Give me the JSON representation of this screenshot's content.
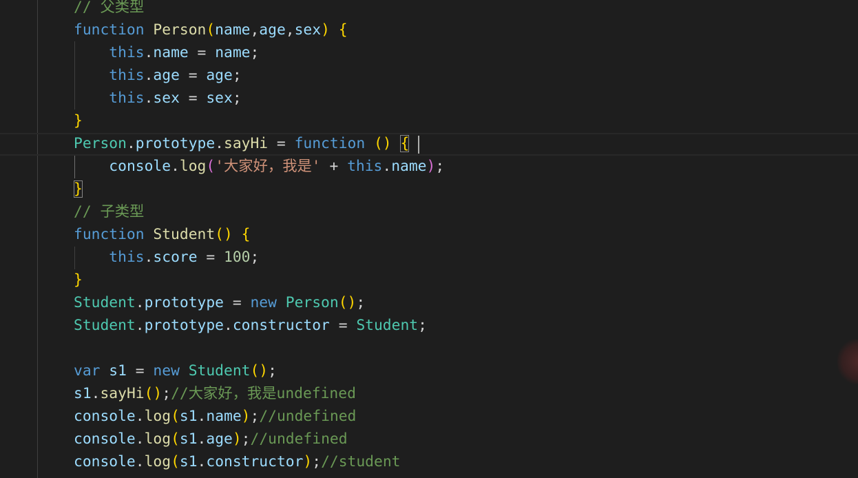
{
  "editor": {
    "language": "javascript",
    "colors": {
      "background": "#1e1e1e",
      "keyword": "#569cd6",
      "function": "#dcdcaa",
      "class": "#4ec9b0",
      "variable": "#9cdcfe",
      "string": "#ce9178",
      "number": "#b5cea8",
      "comment": "#6a9955",
      "bracket_level_1": "#ffd700",
      "bracket_level_2": "#da70d6"
    },
    "lines": [
      {
        "tokens": [
          {
            "t": "// 父类型",
            "k": "comment"
          }
        ]
      },
      {
        "tokens": [
          {
            "t": "function",
            "k": "keyword"
          },
          {
            "t": " ",
            "k": "punct"
          },
          {
            "t": "Person",
            "k": "function"
          },
          {
            "t": "(",
            "k": "bracket-1"
          },
          {
            "t": "name",
            "k": "param"
          },
          {
            "t": ",",
            "k": "punct"
          },
          {
            "t": "age",
            "k": "param"
          },
          {
            "t": ",",
            "k": "punct"
          },
          {
            "t": "sex",
            "k": "param"
          },
          {
            "t": ")",
            "k": "bracket-1"
          },
          {
            "t": " ",
            "k": "punct"
          },
          {
            "t": "{",
            "k": "bracket-1"
          }
        ]
      },
      {
        "tokens": [
          {
            "t": "    ",
            "k": "punct"
          },
          {
            "t": "this",
            "k": "keyword"
          },
          {
            "t": ".",
            "k": "punct"
          },
          {
            "t": "name",
            "k": "property"
          },
          {
            "t": " = ",
            "k": "operator"
          },
          {
            "t": "name",
            "k": "param"
          },
          {
            "t": ";",
            "k": "punct"
          }
        ]
      },
      {
        "tokens": [
          {
            "t": "    ",
            "k": "punct"
          },
          {
            "t": "this",
            "k": "keyword"
          },
          {
            "t": ".",
            "k": "punct"
          },
          {
            "t": "age",
            "k": "property"
          },
          {
            "t": " = ",
            "k": "operator"
          },
          {
            "t": "age",
            "k": "param"
          },
          {
            "t": ";",
            "k": "punct"
          }
        ]
      },
      {
        "tokens": [
          {
            "t": "    ",
            "k": "punct"
          },
          {
            "t": "this",
            "k": "keyword"
          },
          {
            "t": ".",
            "k": "punct"
          },
          {
            "t": "sex",
            "k": "property"
          },
          {
            "t": " = ",
            "k": "operator"
          },
          {
            "t": "sex",
            "k": "param"
          },
          {
            "t": ";",
            "k": "punct"
          }
        ]
      },
      {
        "tokens": [
          {
            "t": "}",
            "k": "bracket-1"
          }
        ]
      },
      {
        "tokens": [
          {
            "t": "Person",
            "k": "class"
          },
          {
            "t": ".",
            "k": "punct"
          },
          {
            "t": "prototype",
            "k": "property"
          },
          {
            "t": ".",
            "k": "punct"
          },
          {
            "t": "sayHi",
            "k": "function"
          },
          {
            "t": " = ",
            "k": "operator"
          },
          {
            "t": "function",
            "k": "keyword"
          },
          {
            "t": " ",
            "k": "punct"
          },
          {
            "t": "()",
            "k": "bracket-1"
          },
          {
            "t": " ",
            "k": "punct"
          },
          {
            "t": "{",
            "k": "bracket-1",
            "match": true
          }
        ]
      },
      {
        "tokens": [
          {
            "t": "    ",
            "k": "punct"
          },
          {
            "t": "console",
            "k": "variable"
          },
          {
            "t": ".",
            "k": "punct"
          },
          {
            "t": "log",
            "k": "function"
          },
          {
            "t": "(",
            "k": "bracket-2"
          },
          {
            "t": "'大家好，我是'",
            "k": "string"
          },
          {
            "t": " + ",
            "k": "operator"
          },
          {
            "t": "this",
            "k": "keyword"
          },
          {
            "t": ".",
            "k": "punct"
          },
          {
            "t": "name",
            "k": "property"
          },
          {
            "t": ")",
            "k": "bracket-2"
          },
          {
            "t": ";",
            "k": "punct"
          }
        ]
      },
      {
        "tokens": [
          {
            "t": "}",
            "k": "bracket-1",
            "match": true
          }
        ]
      },
      {
        "tokens": [
          {
            "t": "// 子类型",
            "k": "comment"
          }
        ]
      },
      {
        "tokens": [
          {
            "t": "function",
            "k": "keyword"
          },
          {
            "t": " ",
            "k": "punct"
          },
          {
            "t": "Student",
            "k": "function"
          },
          {
            "t": "()",
            "k": "bracket-1"
          },
          {
            "t": " ",
            "k": "punct"
          },
          {
            "t": "{",
            "k": "bracket-1"
          }
        ]
      },
      {
        "tokens": [
          {
            "t": "    ",
            "k": "punct"
          },
          {
            "t": "this",
            "k": "keyword"
          },
          {
            "t": ".",
            "k": "punct"
          },
          {
            "t": "score",
            "k": "property"
          },
          {
            "t": " = ",
            "k": "operator"
          },
          {
            "t": "100",
            "k": "number"
          },
          {
            "t": ";",
            "k": "punct"
          }
        ]
      },
      {
        "tokens": [
          {
            "t": "}",
            "k": "bracket-1"
          }
        ]
      },
      {
        "tokens": [
          {
            "t": "Student",
            "k": "class"
          },
          {
            "t": ".",
            "k": "punct"
          },
          {
            "t": "prototype",
            "k": "property"
          },
          {
            "t": " = ",
            "k": "operator"
          },
          {
            "t": "new",
            "k": "keyword"
          },
          {
            "t": " ",
            "k": "punct"
          },
          {
            "t": "Person",
            "k": "class"
          },
          {
            "t": "()",
            "k": "bracket-1"
          },
          {
            "t": ";",
            "k": "punct"
          }
        ]
      },
      {
        "tokens": [
          {
            "t": "Student",
            "k": "class"
          },
          {
            "t": ".",
            "k": "punct"
          },
          {
            "t": "prototype",
            "k": "property"
          },
          {
            "t": ".",
            "k": "punct"
          },
          {
            "t": "constructor",
            "k": "property"
          },
          {
            "t": " = ",
            "k": "operator"
          },
          {
            "t": "Student",
            "k": "class"
          },
          {
            "t": ";",
            "k": "punct"
          }
        ]
      },
      {
        "tokens": []
      },
      {
        "tokens": [
          {
            "t": "var",
            "k": "keyword"
          },
          {
            "t": " ",
            "k": "punct"
          },
          {
            "t": "s1",
            "k": "variable"
          },
          {
            "t": " = ",
            "k": "operator"
          },
          {
            "t": "new",
            "k": "keyword"
          },
          {
            "t": " ",
            "k": "punct"
          },
          {
            "t": "Student",
            "k": "class"
          },
          {
            "t": "()",
            "k": "bracket-1"
          },
          {
            "t": ";",
            "k": "punct"
          }
        ]
      },
      {
        "tokens": [
          {
            "t": "s1",
            "k": "variable"
          },
          {
            "t": ".",
            "k": "punct"
          },
          {
            "t": "sayHi",
            "k": "function"
          },
          {
            "t": "()",
            "k": "bracket-1"
          },
          {
            "t": ";",
            "k": "punct"
          },
          {
            "t": "//大家好，我是undefined",
            "k": "comment"
          }
        ]
      },
      {
        "tokens": [
          {
            "t": "console",
            "k": "variable"
          },
          {
            "t": ".",
            "k": "punct"
          },
          {
            "t": "log",
            "k": "function"
          },
          {
            "t": "(",
            "k": "bracket-1"
          },
          {
            "t": "s1",
            "k": "variable"
          },
          {
            "t": ".",
            "k": "punct"
          },
          {
            "t": "name",
            "k": "property"
          },
          {
            "t": ")",
            "k": "bracket-1"
          },
          {
            "t": ";",
            "k": "punct"
          },
          {
            "t": "//undefined",
            "k": "comment"
          }
        ]
      },
      {
        "tokens": [
          {
            "t": "console",
            "k": "variable"
          },
          {
            "t": ".",
            "k": "punct"
          },
          {
            "t": "log",
            "k": "function"
          },
          {
            "t": "(",
            "k": "bracket-1"
          },
          {
            "t": "s1",
            "k": "variable"
          },
          {
            "t": ".",
            "k": "punct"
          },
          {
            "t": "age",
            "k": "property"
          },
          {
            "t": ")",
            "k": "bracket-1"
          },
          {
            "t": ";",
            "k": "punct"
          },
          {
            "t": "//undefined",
            "k": "comment"
          }
        ]
      },
      {
        "tokens": [
          {
            "t": "console",
            "k": "variable"
          },
          {
            "t": ".",
            "k": "punct"
          },
          {
            "t": "log",
            "k": "function"
          },
          {
            "t": "(",
            "k": "bracket-1"
          },
          {
            "t": "s1",
            "k": "variable"
          },
          {
            "t": ".",
            "k": "punct"
          },
          {
            "t": "constructor",
            "k": "property"
          },
          {
            "t": ")",
            "k": "bracket-1"
          },
          {
            "t": ";",
            "k": "punct"
          },
          {
            "t": "//student",
            "k": "comment"
          }
        ]
      }
    ]
  }
}
